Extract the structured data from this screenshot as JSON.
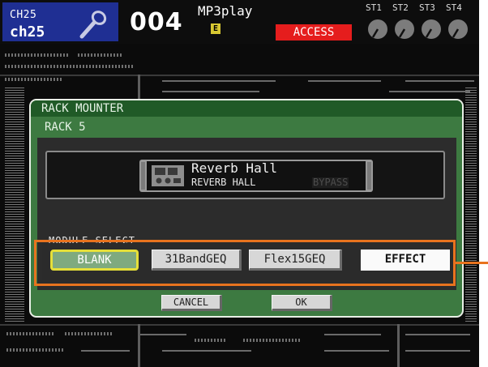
{
  "channel": {
    "number_label": "CH25",
    "name": "ch25"
  },
  "scene": {
    "number": "004",
    "title": "MP3play",
    "flag": "E"
  },
  "status": {
    "access_badge": "ACCESS"
  },
  "stereo": {
    "labels": [
      "ST1",
      "ST2",
      "ST3",
      "ST4"
    ]
  },
  "dialog": {
    "title": "RACK MOUNTER",
    "subtitle": "RACK 5",
    "module": {
      "name": "Reverb Hall",
      "type": "REVERB HALL",
      "bypass": "BYPASS"
    },
    "module_select": {
      "label": "MODULE SELECT",
      "options": [
        "BLANK",
        "31BandGEQ",
        "Flex15GEQ",
        "EFFECT"
      ],
      "highlighted": "BLANK",
      "selected": "EFFECT"
    },
    "actions": {
      "cancel": "CANCEL",
      "ok": "OK"
    }
  },
  "colors": {
    "channel_bg": "#1f2f93",
    "access_red": "#e51d1d",
    "dialog_green": "#3d7a41",
    "title_green": "#205a27",
    "highlight_yellow": "#e5df3a",
    "callout_orange": "#e8731e"
  },
  "icons": {
    "channel": "microphone-icon",
    "module": "effect-unit-icon",
    "stereo": "knob-icon"
  }
}
